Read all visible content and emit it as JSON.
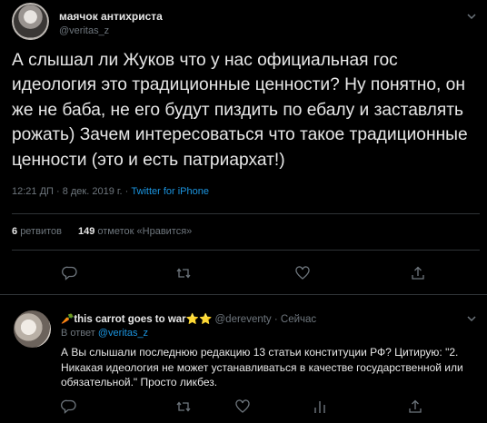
{
  "main_tweet": {
    "author_name": "маячок антихриста",
    "author_handle": "@veritas_z",
    "text": "А слышал ли Жуков что у нас официальная гос идеология это традиционные ценности? Ну понятно, он же не баба, не его будут пиздить по ебалу и заставлять рожать) Зачем интересоваться что такое традиционные ценности (это и есть патриархат!)",
    "timestamp": "12:21 ДП · 8 дек. 2019 г. · ",
    "source": "Twitter for iPhone",
    "retweets_count": "6",
    "retweets_label": "ретвитов",
    "likes_count": "149",
    "likes_label": "отметок «Нравится»"
  },
  "reply_tweet": {
    "author_name": "🥕this carrot goes to war⭐⭐",
    "author_handle": "@dereventy · Сейчас",
    "reply_prefix": "В ответ ",
    "reply_to_handle": "@veritas_z",
    "text": "А Вы слышали последнюю редакцию 13 статьи конституции РФ? Цитирую: \"2. Никакая идеология не может устанавливаться в качестве государственной или обязательной.\" Просто ликбез."
  },
  "icons": [
    "chevron-down-icon",
    "reply-icon",
    "retweet-icon",
    "like-icon",
    "share-icon"
  ],
  "colors": {
    "background": "#000000",
    "text": "#e7e7e7",
    "muted": "#6e767d",
    "link": "#1b95e0",
    "divider": "#2f3336"
  }
}
